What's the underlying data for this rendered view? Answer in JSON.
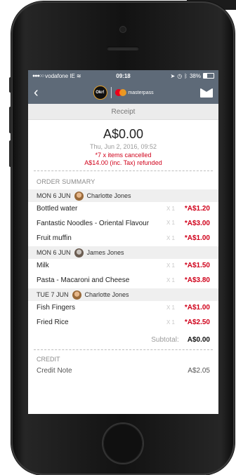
{
  "status_bar": {
    "carrier": "vodafone IE",
    "time": "09:18",
    "battery": "38%"
  },
  "nav_bar": {
    "logo_text": "Okr!",
    "partner_text": "masterpass"
  },
  "receipt_label": "Receipt",
  "summary": {
    "amount": "A$0.00",
    "date": "Thu, Jun 2, 2016, 09:52",
    "cancelled": "*7 x items cancelled",
    "refunded": "A$14.00 (inc. Tax) refunded"
  },
  "order_summary_title": "ORDER SUMMARY",
  "days": [
    {
      "day": "MON 6 JUN",
      "person": "Charlotte  Jones",
      "items": [
        {
          "name": "Bottled water",
          "qty": "X 1",
          "price": "*A$1.20"
        },
        {
          "name": "Fantastic Noodles - Oriental Flavour",
          "qty": "X 1",
          "price": "*A$3.00"
        },
        {
          "name": "Fruit muffin",
          "qty": "X 1",
          "price": "*A$1.00"
        }
      ]
    },
    {
      "day": "MON 6 JUN",
      "person": "James Jones",
      "items": [
        {
          "name": "Milk",
          "qty": "X 1",
          "price": "*A$1.50"
        },
        {
          "name": "Pasta - Macaroni and Cheese",
          "qty": "X 1",
          "price": "*A$3.80"
        }
      ]
    },
    {
      "day": "TUE 7 JUN",
      "person": "Charlotte  Jones",
      "items": [
        {
          "name": "Fish Fingers",
          "qty": "X 1",
          "price": "*A$1.00"
        },
        {
          "name": "Fried Rice",
          "qty": "X 1",
          "price": "*A$2.50"
        }
      ]
    }
  ],
  "subtotal": {
    "label": "Subtotal:",
    "value": "A$0.00"
  },
  "credit": {
    "title": "CREDIT",
    "item_name": "Credit Note",
    "item_value": "A$2.05"
  },
  "colors": {
    "header": "#5e6a78",
    "price_red": "#d0021b"
  }
}
